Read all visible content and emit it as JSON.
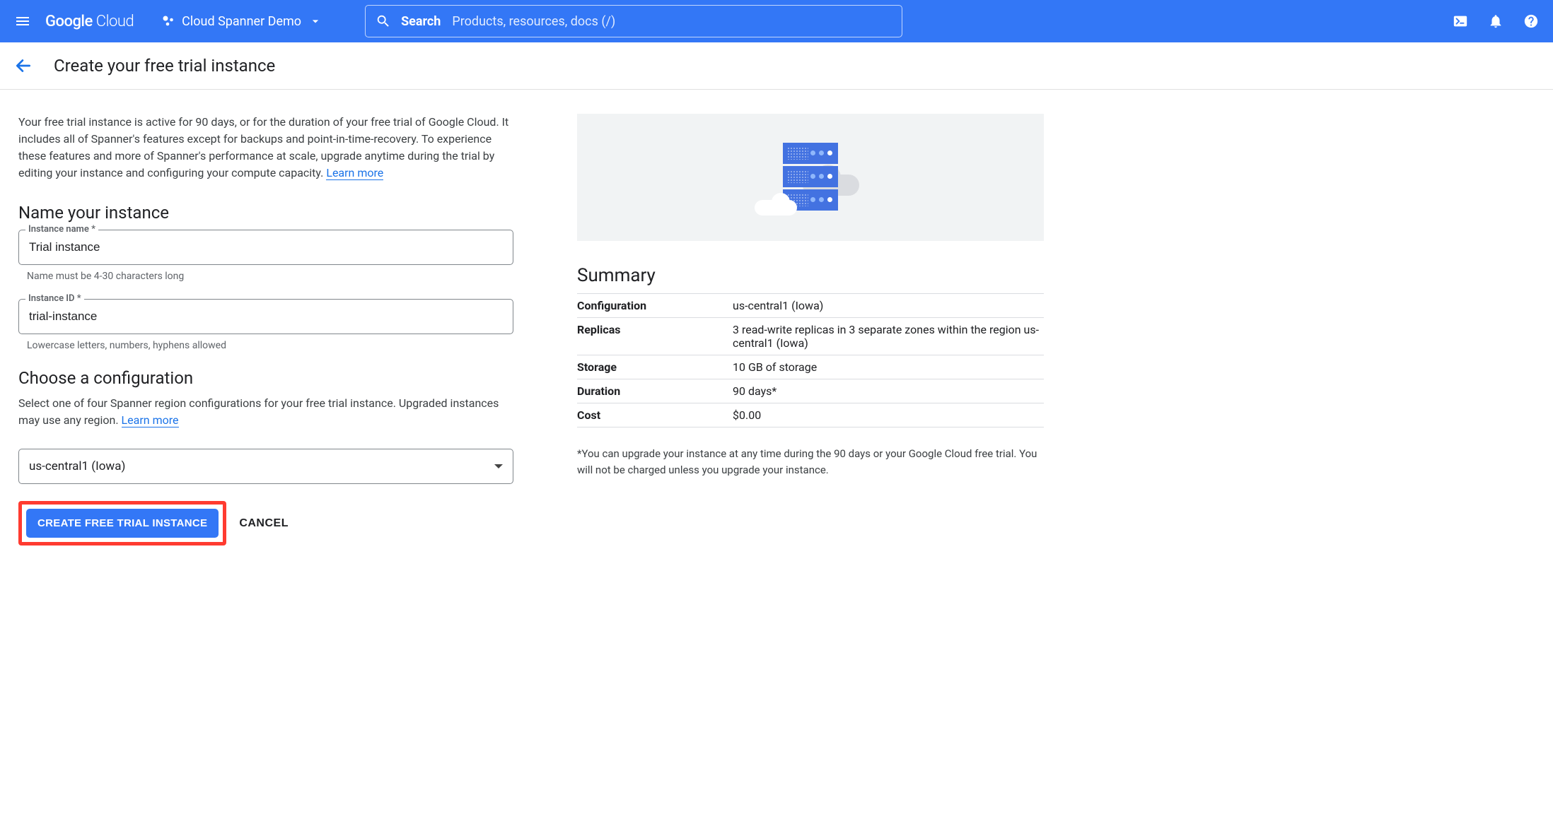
{
  "topbar": {
    "logo_text_bold": "Google",
    "logo_text_light": "Cloud",
    "project_name": "Cloud Spanner Demo",
    "search_label": "Search",
    "search_placeholder": "Products, resources, docs (/)"
  },
  "page": {
    "title": "Create your free trial instance"
  },
  "intro": {
    "text": "Your free trial instance is active for 90 days, or for the duration of your free trial of Google Cloud. It includes all of Spanner's features except for backups and point-in-time-recovery. To experience these features and more of Spanner's performance at scale, upgrade anytime during the trial by editing your instance and configuring your compute capacity. ",
    "learn_more": "Learn more"
  },
  "section_name": {
    "title": "Name your instance",
    "instance_name_label": "Instance name *",
    "instance_name_value": "Trial instance",
    "instance_name_help": "Name must be 4-30 characters long",
    "instance_id_label": "Instance ID *",
    "instance_id_value": "trial-instance",
    "instance_id_help": "Lowercase letters, numbers, hyphens allowed"
  },
  "section_config": {
    "title": "Choose a configuration",
    "desc": "Select one of four Spanner region configurations for your free trial instance. Upgraded instances may use any region. ",
    "learn_more": "Learn more",
    "select_value": "us-central1 (Iowa)"
  },
  "buttons": {
    "create": "CREATE FREE TRIAL INSTANCE",
    "cancel": "CANCEL"
  },
  "summary": {
    "title": "Summary",
    "rows": [
      {
        "label": "Configuration",
        "value": "us-central1 (Iowa)"
      },
      {
        "label": "Replicas",
        "value": "3 read-write replicas in 3 separate zones within the region us-central1 (Iowa)"
      },
      {
        "label": "Storage",
        "value": "10 GB of storage"
      },
      {
        "label": "Duration",
        "value": "90 days*"
      },
      {
        "label": "Cost",
        "value": "$0.00"
      }
    ],
    "note": "*You can upgrade your instance at any time during the 90 days or your Google Cloud free trial. You will not be charged unless you upgrade your instance."
  }
}
